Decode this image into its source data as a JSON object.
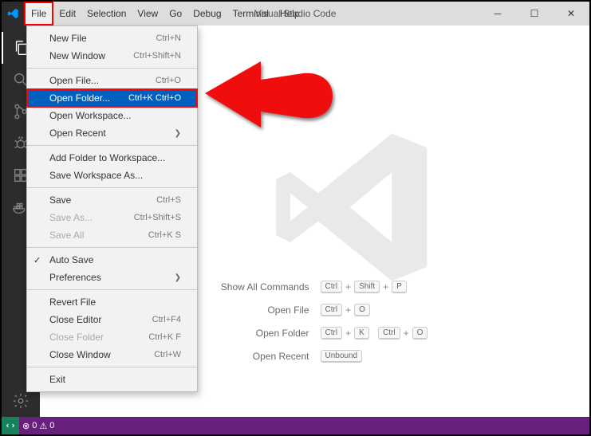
{
  "title": "Visual Studio Code",
  "menubar": [
    "File",
    "Edit",
    "Selection",
    "View",
    "Go",
    "Debug",
    "Terminal",
    "Help"
  ],
  "activeMenuIndex": 0,
  "dropdown": {
    "groups": [
      [
        {
          "label": "New File",
          "shortcut": "Ctrl+N"
        },
        {
          "label": "New Window",
          "shortcut": "Ctrl+Shift+N"
        }
      ],
      [
        {
          "label": "Open File...",
          "shortcut": "Ctrl+O"
        },
        {
          "label": "Open Folder...",
          "shortcut": "Ctrl+K Ctrl+O",
          "highlight": true
        },
        {
          "label": "Open Workspace..."
        },
        {
          "label": "Open Recent",
          "submenu": true
        }
      ],
      [
        {
          "label": "Add Folder to Workspace..."
        },
        {
          "label": "Save Workspace As..."
        }
      ],
      [
        {
          "label": "Save",
          "shortcut": "Ctrl+S"
        },
        {
          "label": "Save As...",
          "shortcut": "Ctrl+Shift+S",
          "disabled": true
        },
        {
          "label": "Save All",
          "shortcut": "Ctrl+K S",
          "disabled": true
        }
      ],
      [
        {
          "label": "Auto Save",
          "checked": true
        },
        {
          "label": "Preferences",
          "submenu": true
        }
      ],
      [
        {
          "label": "Revert File"
        },
        {
          "label": "Close Editor",
          "shortcut": "Ctrl+F4"
        },
        {
          "label": "Close Folder",
          "shortcut": "Ctrl+K F",
          "disabled": true
        },
        {
          "label": "Close Window",
          "shortcut": "Ctrl+W"
        }
      ],
      [
        {
          "label": "Exit"
        }
      ]
    ]
  },
  "shortcuts": [
    {
      "label": "Show All Commands",
      "keys": [
        "Ctrl",
        "Shift",
        "P"
      ]
    },
    {
      "label": "Open File",
      "keys": [
        "Ctrl",
        "O"
      ]
    },
    {
      "label": "Open Folder",
      "keys": [
        "Ctrl",
        "K",
        "Ctrl",
        "O"
      ]
    },
    {
      "label": "Open Recent",
      "unbound": "Unbound"
    }
  ],
  "activitybar": [
    "files",
    "search",
    "scm",
    "debug",
    "extensions",
    "docker"
  ],
  "statusbar": {
    "errors": "0",
    "warnings": "0"
  }
}
